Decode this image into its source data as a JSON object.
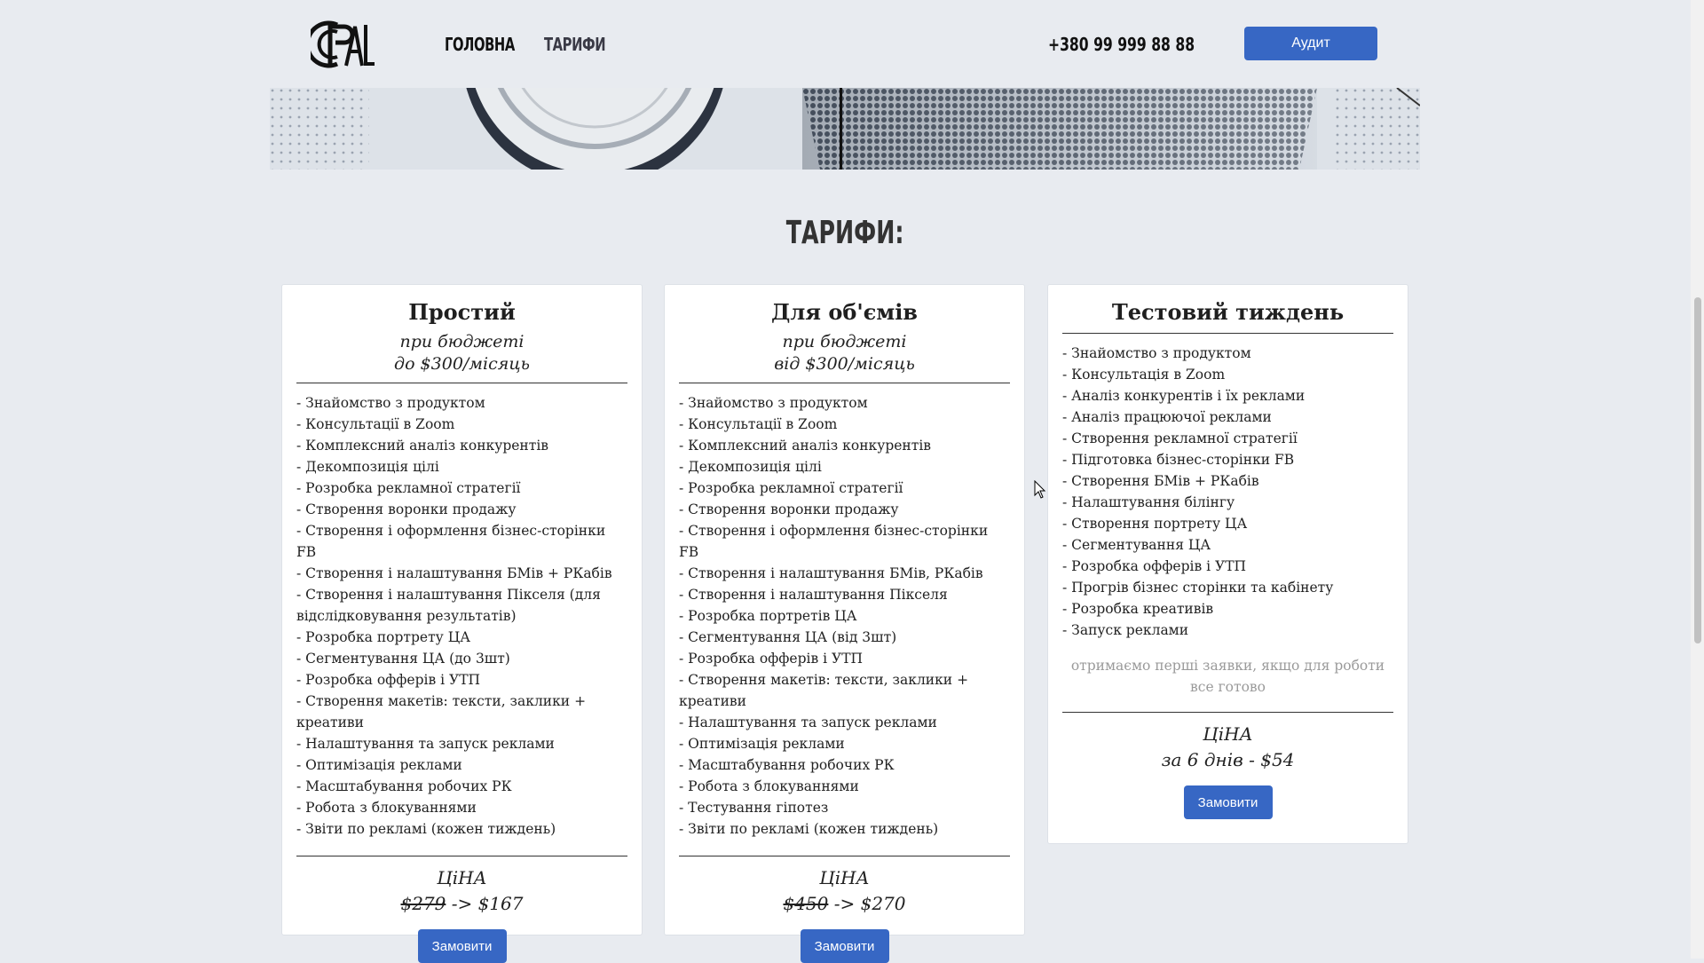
{
  "header": {
    "logo_alt": "PAL",
    "nav": [
      {
        "label": "ГОЛОВНА"
      },
      {
        "label": "ТАРИФИ"
      }
    ],
    "phone": "+380 99 999 88 88",
    "audit_label": "Аудит"
  },
  "section": {
    "title": "ТАРИФИ:"
  },
  "plans": [
    {
      "name": "Простий",
      "budget_line1": "при бюджеті",
      "budget_line2": "до $300/місяць",
      "features": [
        "- Знайомство з продуктом",
        "- Консультації в Zoom",
        "- Комплексний аналіз конкурентів",
        "- Декомпозиція цілі",
        "- Розробка рекламної стратегії",
        "- Створення воронки продажу",
        "- Створення і оформлення бізнес-сторінки FB",
        "- Створення і налаштування БМів + РКабів",
        "- Створення і налаштування Пікселя (для відслідковування результатів)",
        "- Розробка портрету ЦА",
        "- Сегментування ЦА (до 3шт)",
        "- Розробка офферів і УТП",
        "- Створення макетів: тексти, заклики + креативи",
        "- Налаштування та запуск реклами",
        "- Оптимізація реклами",
        "- Масштабування робочих РК",
        "- Робота з блокуваннями",
        "- Звіти по рекламі (кожен тиждень)"
      ],
      "price_label": "ЦіНА",
      "old_price": "$279",
      "new_price": "-> $167",
      "order_label": "Замовити"
    },
    {
      "name": "Для об'ємів",
      "budget_line1": "при бюджеті",
      "budget_line2": "від $300/місяць",
      "features": [
        "- Знайомство з продуктом",
        "- Консультації в Zoom",
        "- Комплексний аналіз конкурентів",
        "- Декомпозиція цілі",
        "- Розробка рекламної стратегії",
        "- Створення воронки продажу",
        "- Створення і оформлення бізнес-сторінки FB",
        "- Створення і налаштування БМів, РКабів",
        "- Створення і налаштування Пікселя",
        "- Розробка портретів ЦА",
        "- Сегментування ЦА (від 3шт)",
        "- Розробка офферів і УТП",
        "- Створення макетів: тексти, заклики + креативи",
        "- Налаштування та запуск реклами",
        "- Оптимізація реклами",
        "- Масштабування робочих РК",
        "- Робота з блокуваннями",
        "- Тестування гіпотез",
        "- Звіти по рекламі (кожен тиждень)"
      ],
      "price_label": "ЦіНА",
      "old_price": "$450",
      "new_price": "-> $270",
      "order_label": "Замовити"
    },
    {
      "name": "Тестовий тиждень",
      "features": [
        "- Знайомство з продуктом",
        "- Консультація в Zoom",
        "- Аналіз конкурентів і їх реклами",
        "- Аналіз працюючої реклами",
        "- Створення рекламної стратегії",
        "- Підготовка бізнес-сторінки FB",
        "- Створення БМів + РКабів",
        "- Налаштування білінгу",
        "- Створення портрету ЦА",
        "- Сегментування ЦА",
        "- Розробка офферів і УТП",
        "- Прогрів бізнес сторінки та кабінету",
        "- Розробка креативів",
        "- Запуск реклами"
      ],
      "note": "отримаємо перші заявки, якщо для роботи все готово",
      "price_label": "ЦіНА",
      "price": "за 6 днів - $54",
      "order_label": "Замовити"
    }
  ]
}
